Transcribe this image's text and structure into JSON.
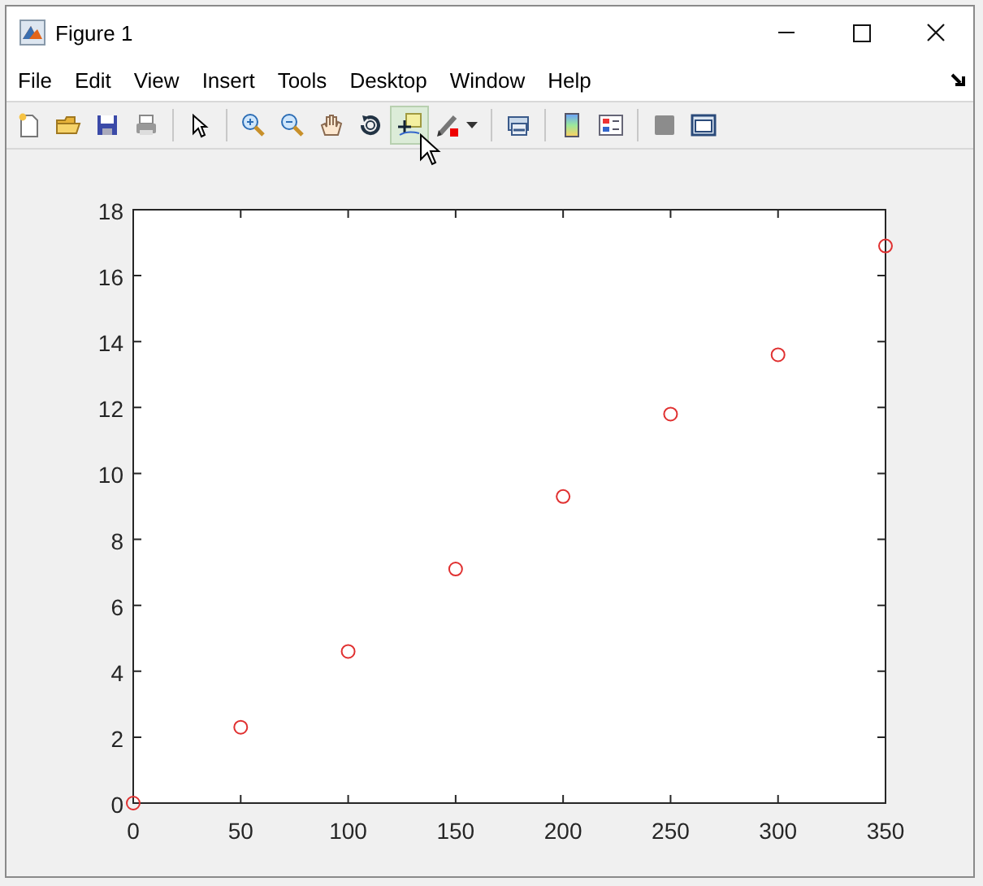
{
  "window": {
    "title": "Figure 1"
  },
  "menu": [
    "File",
    "Edit",
    "View",
    "Insert",
    "Tools",
    "Desktop",
    "Window",
    "Help"
  ],
  "toolbar_groups": [
    [
      {
        "selected": false
      },
      {
        "selected": false
      },
      {
        "selected": false
      },
      {
        "selected": false
      }
    ],
    [
      {
        "selected": false
      }
    ],
    [
      {
        "selected": false
      },
      {
        "selected": false
      },
      {
        "selected": false
      },
      {
        "selected": false
      },
      {
        "selected": true
      },
      {
        "selected": false
      }
    ],
    [
      {
        "selected": false
      }
    ],
    [
      {
        "selected": false
      },
      {
        "selected": false
      }
    ],
    [
      {
        "selected": false
      },
      {
        "selected": false
      }
    ]
  ],
  "chart_data": {
    "type": "scatter",
    "x": [
      0,
      50,
      100,
      150,
      200,
      250,
      300,
      350
    ],
    "series": [
      {
        "color": "#e03030",
        "values": [
          0,
          2.3,
          4.6,
          7.1,
          9.3,
          11.8,
          13.6,
          16.9
        ]
      }
    ],
    "xlim": [
      0,
      350
    ],
    "ylim": [
      0,
      18
    ],
    "xticks": [
      0,
      50,
      100,
      150,
      200,
      250,
      300,
      350
    ],
    "yticks": [
      0,
      2,
      4,
      6,
      8,
      10,
      12,
      14,
      16,
      18
    ]
  }
}
